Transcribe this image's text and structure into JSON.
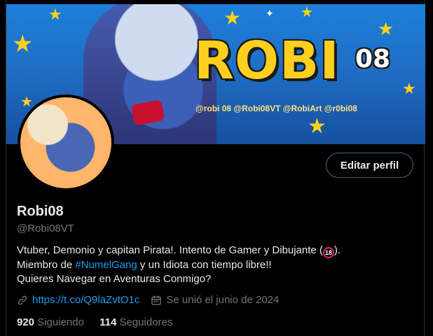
{
  "banner": {
    "logo_text": "ROBI",
    "logo_number": "08",
    "socials": "@robi 08  @Robi08VT  @RobiArt  @r0bi08"
  },
  "profile": {
    "edit_button": "Editar perfil",
    "display_name": "Robi08",
    "handle": "@Robi08VT",
    "bio_line1": "Vtuber, Demonio y capitan Pirata!. Intento de Gamer y Dibujante (",
    "bio_line1_badge": "18",
    "bio_line1_end": ").",
    "bio_line2_start": "Miembro de ",
    "bio_hashtag": "#NumelGang",
    "bio_line2_end": " y un Idiota con tiempo libre!!",
    "bio_line3": "Quieres Navegar en Aventuras Conmigo?",
    "link": "https://t.co/Q9laZvtO1c",
    "joined": "Se unió el junio de 2024",
    "following_count": "920",
    "following_label": "Siguiendo",
    "followers_count": "114",
    "followers_label": "Seguidores"
  },
  "colors": {
    "accent": "#1d9bf0",
    "background": "#000000",
    "muted": "#71767b"
  }
}
